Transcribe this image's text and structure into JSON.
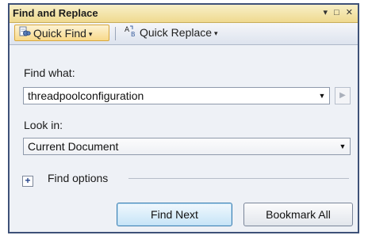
{
  "window": {
    "title": "Find and Replace",
    "controls": {
      "pin": "▾",
      "maximize": "□",
      "close": "✕"
    }
  },
  "toolbar": {
    "quick_find": {
      "label": "Quick Find",
      "icon": "binoculars-icon",
      "active": true
    },
    "quick_replace": {
      "label": "Quick Replace",
      "icon": "replace-icon"
    }
  },
  "find_what": {
    "label": "Find what:",
    "value": "threadpoolconfiguration"
  },
  "look_in": {
    "label": "Look in:",
    "value": "Current Document"
  },
  "find_options": {
    "label": "Find options",
    "expander_symbol": "+"
  },
  "buttons": {
    "find_next": "Find Next",
    "bookmark_all": "Bookmark All"
  },
  "colors": {
    "window_border": "#3e5178",
    "title_bar": "#efd98f",
    "active_tab": "#f8d98a",
    "primary_button": "#c6e4f7"
  }
}
